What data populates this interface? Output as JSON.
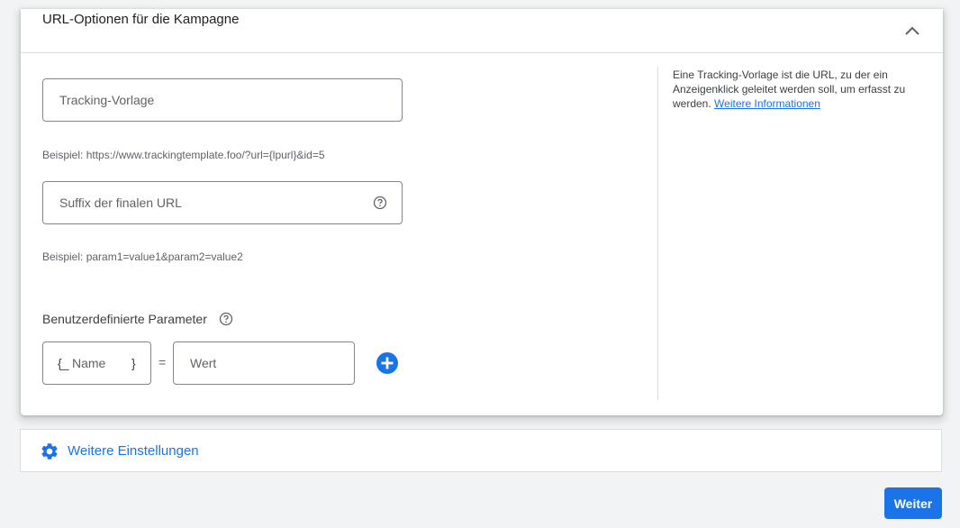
{
  "card": {
    "title": "URL-Optionen für die Kampagne",
    "collapse_icon": "chevron-up-icon"
  },
  "tracking_template": {
    "placeholder": "Tracking-Vorlage",
    "value": "",
    "hint": "Beispiel: https://www.trackingtemplate.foo/?url={lpurl}&id=5"
  },
  "final_url_suffix": {
    "placeholder": "Suffix der finalen URL",
    "value": "",
    "hint": "Beispiel: param1=value1&param2=value2",
    "help_icon": "help-circle-icon"
  },
  "custom_params": {
    "label": "Benutzerdefinierte Parameter",
    "help_icon": "help-circle-icon",
    "name_prefix": "{_",
    "name_placeholder": "Name",
    "name_suffix": "}",
    "equals": "=",
    "value_placeholder": "Wert",
    "add_icon": "add-circle-icon"
  },
  "side_help": {
    "text": "Eine Tracking-Vorlage ist die URL, zu der ein Anzeigenklick geleitet werden soll, um erfasst zu werden.",
    "link": "Weitere Informationen"
  },
  "more_settings": {
    "label": "Weitere Einstellungen",
    "icon": "gear-icon"
  },
  "next_button": {
    "label": "Weiter"
  },
  "colors": {
    "accent": "#1a73e8",
    "background": "#f1f3f4",
    "border": "#80868b"
  }
}
